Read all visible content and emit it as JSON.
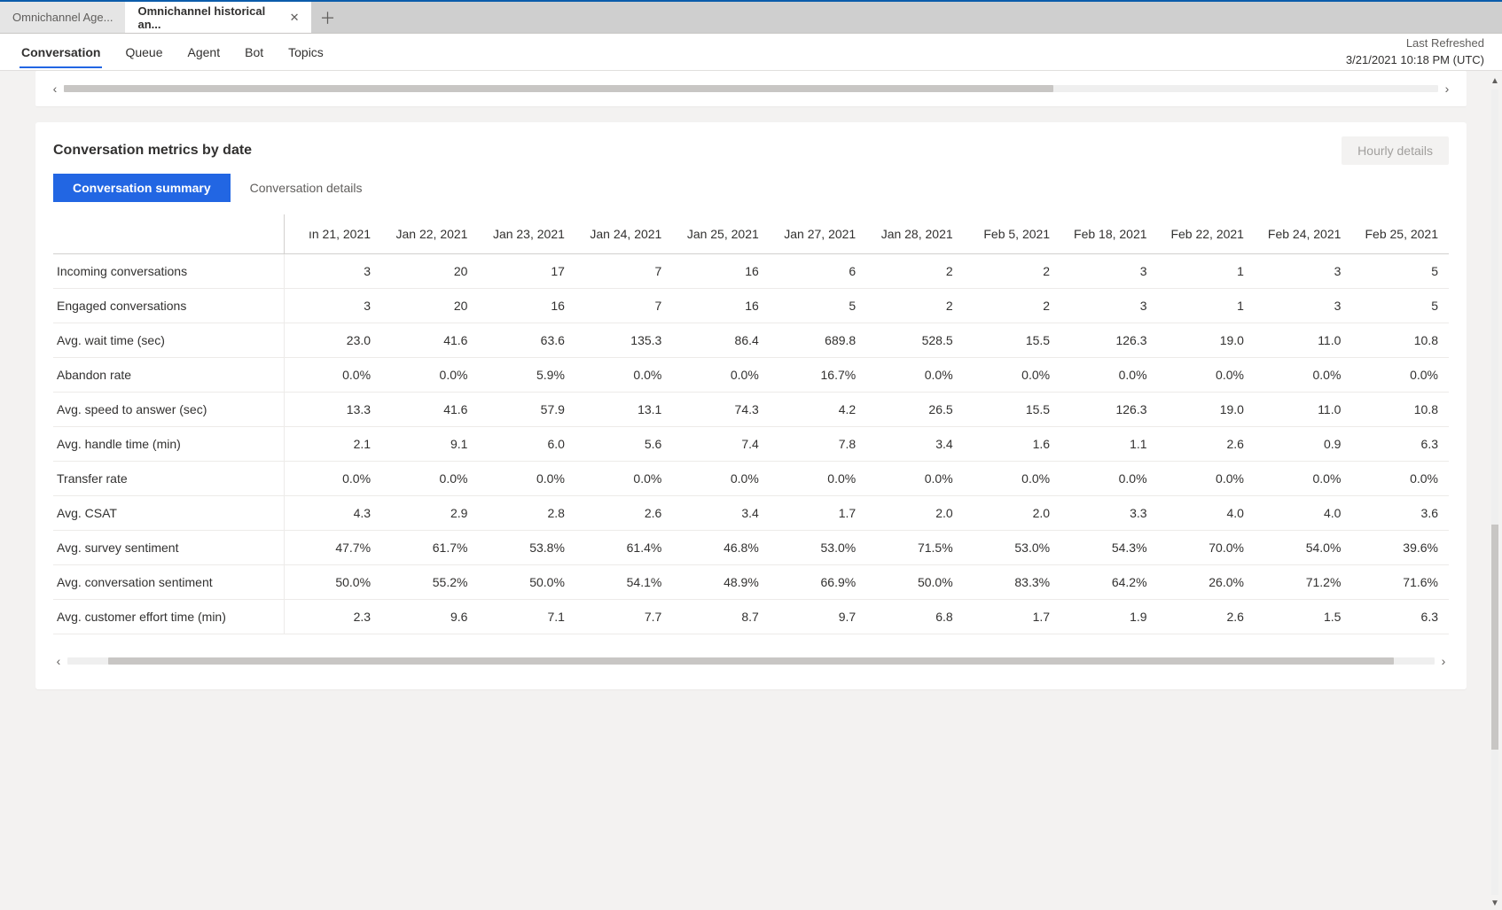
{
  "tabs": {
    "inactive_label": "Omnichannel Age...",
    "active_label": "Omnichannel historical an..."
  },
  "ribbon": {
    "items": [
      "Conversation",
      "Queue",
      "Agent",
      "Bot",
      "Topics"
    ],
    "active_index": 0
  },
  "refreshed": {
    "label": "Last Refreshed",
    "timestamp": "3/21/2021 10:18 PM (UTC)"
  },
  "card": {
    "title": "Conversation metrics by date",
    "hourly_button": "Hourly details",
    "subtabs": {
      "summary": "Conversation summary",
      "details": "Conversation details"
    }
  },
  "chart_data": {
    "type": "table",
    "columns": [
      "ın 21, 2021",
      "Jan 22, 2021",
      "Jan 23, 2021",
      "Jan 24, 2021",
      "Jan 25, 2021",
      "Jan 27, 2021",
      "Jan 28, 2021",
      "Feb 5, 2021",
      "Feb 18, 2021",
      "Feb 22, 2021",
      "Feb 24, 2021",
      "Feb 25, 2021"
    ],
    "rows": [
      {
        "metric": "Incoming conversations",
        "values": [
          "3",
          "20",
          "17",
          "7",
          "16",
          "6",
          "2",
          "2",
          "3",
          "1",
          "3",
          "5"
        ]
      },
      {
        "metric": "Engaged conversations",
        "values": [
          "3",
          "20",
          "16",
          "7",
          "16",
          "5",
          "2",
          "2",
          "3",
          "1",
          "3",
          "5"
        ]
      },
      {
        "metric": "Avg. wait time (sec)",
        "values": [
          "23.0",
          "41.6",
          "63.6",
          "135.3",
          "86.4",
          "689.8",
          "528.5",
          "15.5",
          "126.3",
          "19.0",
          "11.0",
          "10.8"
        ]
      },
      {
        "metric": "Abandon rate",
        "values": [
          "0.0%",
          "0.0%",
          "5.9%",
          "0.0%",
          "0.0%",
          "16.7%",
          "0.0%",
          "0.0%",
          "0.0%",
          "0.0%",
          "0.0%",
          "0.0%"
        ]
      },
      {
        "metric": "Avg. speed to answer (sec)",
        "values": [
          "13.3",
          "41.6",
          "57.9",
          "13.1",
          "74.3",
          "4.2",
          "26.5",
          "15.5",
          "126.3",
          "19.0",
          "11.0",
          "10.8"
        ]
      },
      {
        "metric": "Avg. handle time (min)",
        "values": [
          "2.1",
          "9.1",
          "6.0",
          "5.6",
          "7.4",
          "7.8",
          "3.4",
          "1.6",
          "1.1",
          "2.6",
          "0.9",
          "6.3"
        ]
      },
      {
        "metric": "Transfer rate",
        "values": [
          "0.0%",
          "0.0%",
          "0.0%",
          "0.0%",
          "0.0%",
          "0.0%",
          "0.0%",
          "0.0%",
          "0.0%",
          "0.0%",
          "0.0%",
          "0.0%"
        ]
      },
      {
        "metric": "Avg. CSAT",
        "values": [
          "4.3",
          "2.9",
          "2.8",
          "2.6",
          "3.4",
          "1.7",
          "2.0",
          "2.0",
          "3.3",
          "4.0",
          "4.0",
          "3.6"
        ]
      },
      {
        "metric": "Avg. survey sentiment",
        "values": [
          "47.7%",
          "61.7%",
          "53.8%",
          "61.4%",
          "46.8%",
          "53.0%",
          "71.5%",
          "53.0%",
          "54.3%",
          "70.0%",
          "54.0%",
          "39.6%"
        ]
      },
      {
        "metric": "Avg. conversation sentiment",
        "values": [
          "50.0%",
          "55.2%",
          "50.0%",
          "54.1%",
          "48.9%",
          "66.9%",
          "50.0%",
          "83.3%",
          "64.2%",
          "26.0%",
          "71.2%",
          "71.6%"
        ]
      },
      {
        "metric": "Avg. customer effort time (min)",
        "values": [
          "2.3",
          "9.6",
          "7.1",
          "7.7",
          "8.7",
          "9.7",
          "6.8",
          "1.7",
          "1.9",
          "2.6",
          "1.5",
          "6.3"
        ]
      }
    ]
  },
  "scrollbar_upper": {
    "thumb_left_pct": 0,
    "thumb_width_pct": 72
  },
  "scrollbar_lower": {
    "thumb_left_pct": 3,
    "thumb_width_pct": 94
  },
  "scrollbar_right": {
    "thumb_top_pct": 54,
    "thumb_height_pct": 28
  }
}
